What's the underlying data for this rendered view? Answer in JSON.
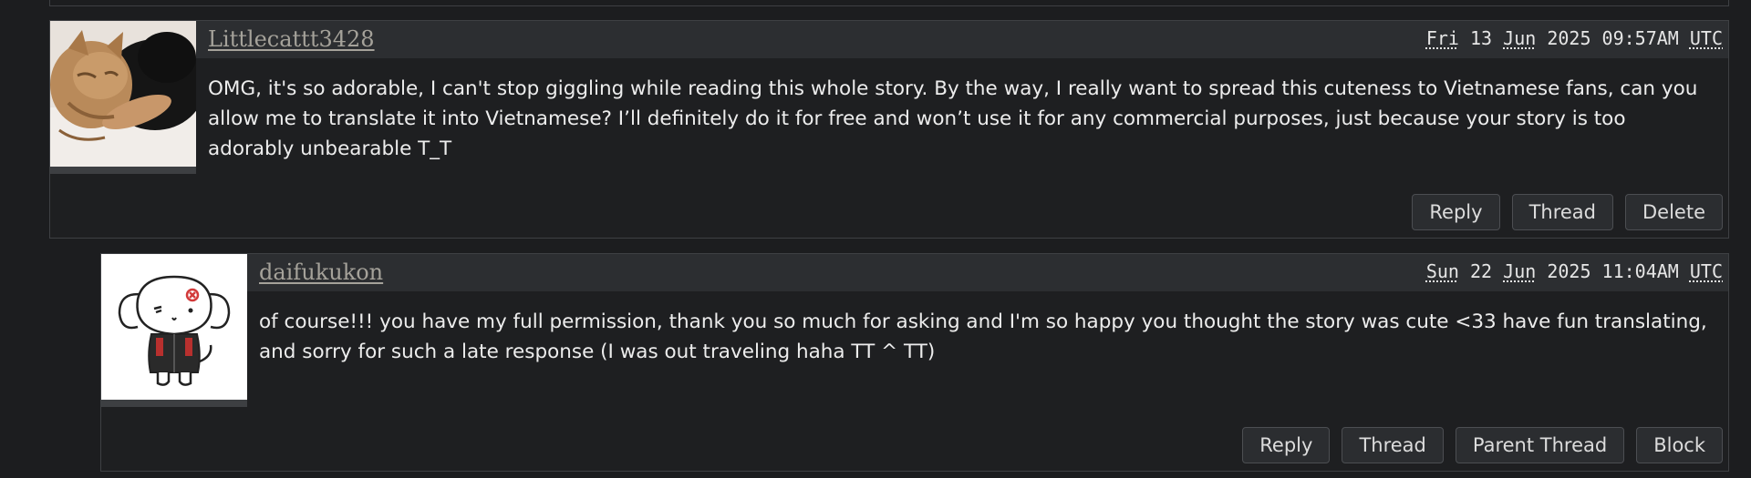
{
  "comments": [
    {
      "username": "Littlecattt3428",
      "date": {
        "day": "Fri",
        "date": "13",
        "month": "Jun",
        "rest": "2025 09:57AM",
        "tz": "UTC"
      },
      "body": "OMG, it's so adorable, I can't stop giggling while reading this whole story. By the way, I really want to spread this cuteness to Vietnamese fans, can you allow me to translate it into Vietnamese? I’ll definitely do it for free and won’t use it for any commercial purposes, just because your story is too adorably unbearable T_T",
      "actions": {
        "reply": "Reply",
        "thread": "Thread",
        "delete": "Delete"
      }
    },
    {
      "username": "daifukukon",
      "date": {
        "day": "Sun",
        "date": "22",
        "month": "Jun",
        "rest": "2025 11:04AM",
        "tz": "UTC"
      },
      "body": "of course!!! you have my full permission, thank you so much for asking and I'm so happy you thought the story was cute <33 have fun translating, and sorry for such a late response (I was out traveling haha TT ^ TT)",
      "actions": {
        "reply": "Reply",
        "thread": "Thread",
        "parent_thread": "Parent Thread",
        "block": "Block"
      }
    }
  ]
}
